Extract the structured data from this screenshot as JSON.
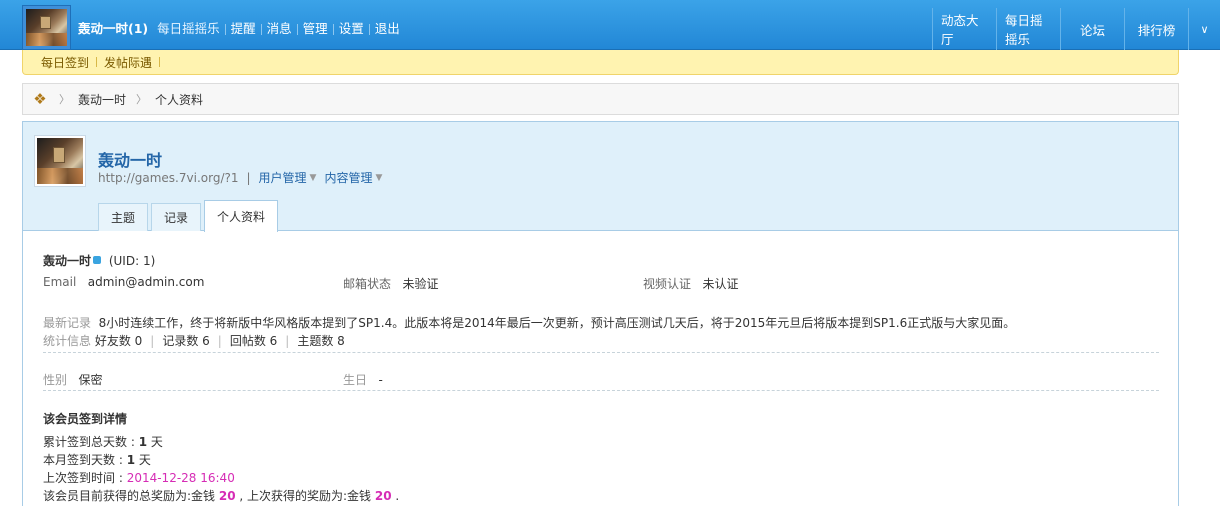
{
  "topbar": {
    "username": "轰动一时(1)",
    "nav": [
      "每日摇摇乐",
      "提醒",
      "消息",
      "管理",
      "设置",
      "退出"
    ],
    "right_tabs": [
      "动态大厅",
      "每日摇摇乐",
      "论坛",
      "排行榜"
    ]
  },
  "subnav": [
    "每日签到",
    "发帖际遇"
  ],
  "breadcrumb": [
    "轰动一时",
    "个人资料"
  ],
  "profile": {
    "name": "轰动一时",
    "url": "http://games.7vi.org/?1",
    "menus": [
      "用户管理",
      "内容管理"
    ],
    "tabs": [
      "主题",
      "记录",
      "个人资料"
    ],
    "active_tab": "个人资料"
  },
  "info": {
    "username": "轰动一时",
    "uid": "(UID: 1)",
    "email_label": "Email",
    "email": "admin@admin.com",
    "email_status_label": "邮箱状态",
    "email_status": "未验证",
    "video_label": "视频认证",
    "video_status": "未认证",
    "latest_label": "最新记录",
    "latest": "8小时连续工作，终于将新版中华风格版本提到了SP1.4。此版本将是2014年最后一次更新，预计高压测试几天后，将于2015年元旦后将版本提到SP1.6正式版与大家见面。",
    "stats_label": "统计信息",
    "stats": [
      "好友数 0",
      "记录数 6",
      "回帖数 6",
      "主题数 8"
    ],
    "gender_label": "性别",
    "gender": "保密",
    "birthday_label": "生日",
    "birthday": "-"
  },
  "signin": {
    "title": "该会员签到详情",
    "total_label": "累计签到总天数 : ",
    "total_value": "1",
    "total_unit": " 天",
    "month_label": "本月签到天数 : ",
    "month_value": "1",
    "month_unit": " 天",
    "last_label": "上次签到时间 : ",
    "last_value": "2014-12-28 16:40",
    "reward_a": "该会员目前获得的总奖励为:金钱 ",
    "reward_a_value": "20",
    "reward_b": " , 上次获得的奖励为:金钱 ",
    "reward_b_value": "20",
    "reward_end": " ."
  },
  "colors": {
    "topbar": "#2287d6",
    "link": "#2466a8",
    "highlight": "#d62cb5"
  }
}
